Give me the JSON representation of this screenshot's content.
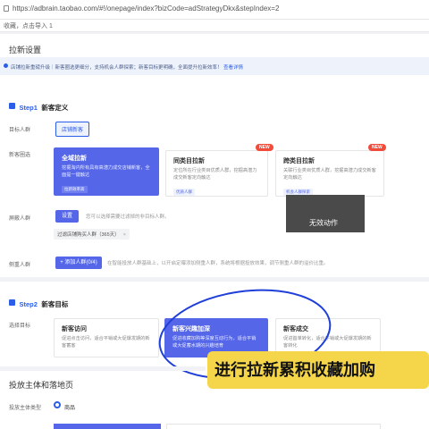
{
  "browser": {
    "url": "https://adbrain.taobao.com/#!/onepage/index?bizCode=adStrategyDkx&stepIndex=2",
    "bookmarks": "收藏，点击导入 1"
  },
  "page": {
    "section_title": "拉新设置",
    "notice": "店铺拉新重磅升级｜新客圈选更细分，支持机会人群探索；新客目标更明确，全面提升拉新效率！",
    "notice_link": "查看详情",
    "step1": {
      "prefix": "Step1",
      "title": "新客定义"
    },
    "target_label": "目标人群",
    "target_chip": "店铺新客",
    "circle_label": "新客圈选",
    "cards1": [
      {
        "title": "全域拉新",
        "desc": "挖掘淘内所有具有高潜力成交店铺新客，全面提一键触达",
        "tag": "拉新效率高"
      },
      {
        "title": "同类目拉新",
        "desc": "定位所在行业类目优质人群，挖掘高潜力成交新客定向触达",
        "tag": "优质人群",
        "badge": "NEW"
      },
      {
        "title": "跨类目拉新",
        "desc": "关联行业类目优质人群，挖掘高潜力成交新客定向触达",
        "tag": "机会人群探索",
        "badge": "NEW"
      }
    ],
    "exclude_label": "屏蔽人群",
    "settings_button": "设置",
    "exclude_hint": "您可以选择需要过滤掉的非目标人群。",
    "exclude_pill": "过滤店铺购买人群（365天）",
    "pill_close": "×",
    "side_label": "侧重人群",
    "add_button": "+ 添加人群(0/4)",
    "side_hint": "在智能投放人群基础上，以开启定曝添加侧重人群，系统将根据投放效果，调节侧重人群的溢价比重。",
    "tooltip": "无效动作",
    "step2": {
      "prefix": "Step2",
      "title": "新客目标"
    },
    "choose_label": "选择目标",
    "cards2": [
      {
        "title": "新客访问",
        "desc": "促进点击访问，适合平销或大促爆发期的新客蓄客"
      },
      {
        "title": "新客兴趣加深",
        "desc": "促进收藏加购等深度互动行为，适合平销或大促蓄水期的兴趣培育"
      },
      {
        "title": "新客成交",
        "desc": "促进首单转化，适合平销或大促爆发期的新客转化"
      }
    ],
    "caption": "进行拉新累积收藏加购",
    "delivery_title": "投放主体和落地页",
    "subject_label": "投放主体类型",
    "subject_option": "商品"
  }
}
